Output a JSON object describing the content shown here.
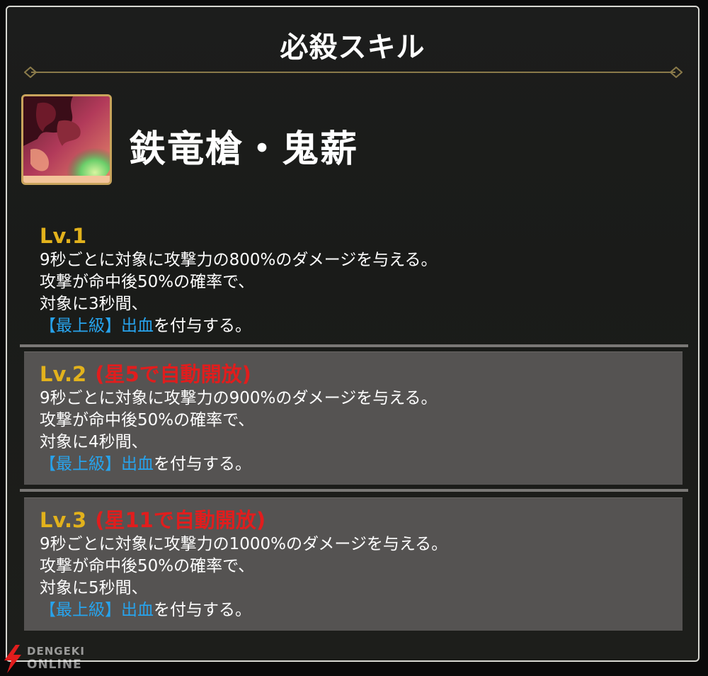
{
  "panel": {
    "title": "必殺スキル"
  },
  "skill": {
    "icon": "skill-portrait-icon",
    "name": "鉄竜槍・鬼薪"
  },
  "levels": [
    {
      "label": "Lv.1",
      "unlock": "",
      "lines": [
        "9秒ごとに対象に攻撃力の800%のダメージを与える。",
        "攻撃が命中後50%の確率で、",
        "対象に3秒間、"
      ],
      "effect_tag": "【最上級】出血",
      "effect_suffix": "を付与する。"
    },
    {
      "label": "Lv.2",
      "unlock": "(星5で自動開放)",
      "lines": [
        "9秒ごとに対象に攻撃力の900%のダメージを与える。",
        "攻撃が命中後50%の確率で、",
        "対象に4秒間、"
      ],
      "effect_tag": "【最上級】出血",
      "effect_suffix": "を付与する。"
    },
    {
      "label": "Lv.3",
      "unlock": "(星11で自動開放)",
      "lines": [
        "9秒ごとに対象に攻撃力の1000%のダメージを与える。",
        "攻撃が命中後50%の確率で、",
        "対象に5秒間、"
      ],
      "effect_tag": "【最上級】出血",
      "effect_suffix": "を付与する。"
    }
  ],
  "watermark": {
    "line1": "DENGEKI",
    "line2": "ONLINE"
  },
  "colors": {
    "level_label": "#e2b21c",
    "unlock_note": "#e11d1d",
    "effect_tag": "#27a3ec",
    "locked_bg": "#555352"
  }
}
